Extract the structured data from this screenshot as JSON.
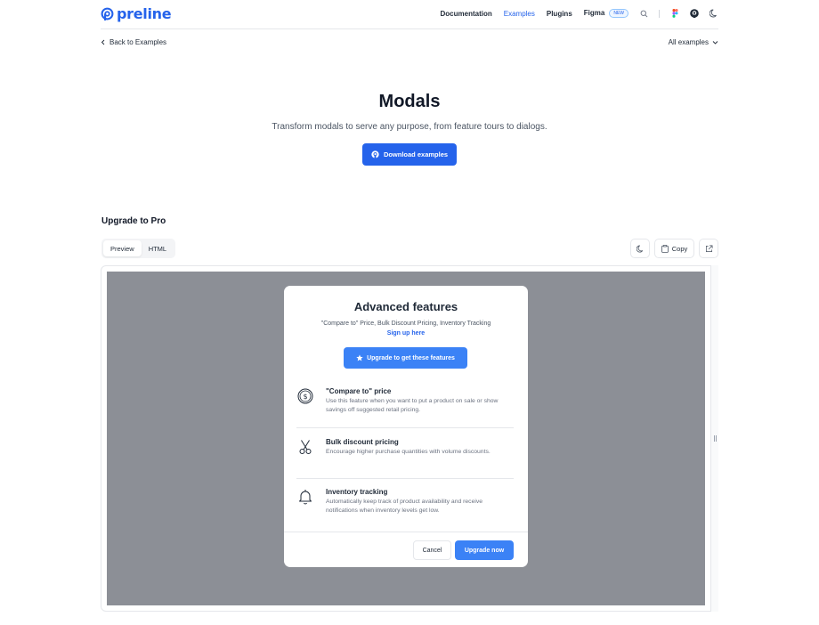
{
  "brand": {
    "name": "preline",
    "accent": "#2563eb"
  },
  "nav": {
    "items": [
      "Documentation",
      "Examples",
      "Plugins",
      "Figma"
    ],
    "active": "Examples",
    "badge": "NEW",
    "icons": [
      "search-icon",
      "figma-icon",
      "github-icon",
      "moon-icon"
    ]
  },
  "subnav": {
    "back": "Back to Examples",
    "all_examples": "All examples"
  },
  "hero": {
    "title": "Modals",
    "subtitle": "Transform modals to serve any purpose, from feature tours to dialogs.",
    "button": "Download examples"
  },
  "section": {
    "title": "Upgrade to Pro",
    "tabs": [
      "Preview",
      "HTML"
    ],
    "active_tab": "Preview",
    "copy_label": "Copy"
  },
  "modal": {
    "title": "Advanced features",
    "desc_text": "\"Compare to\" Price, Bulk Discount Pricing, Inventory Tracking",
    "desc_link": "Sign up here",
    "cta": "Upgrade to get these features",
    "features": [
      {
        "icon": "dollar-circle-icon",
        "title": "\"Compare to\" price",
        "desc": "Use this feature when you want to put a product on sale or show savings off suggested retail pricing."
      },
      {
        "icon": "scissors-icon",
        "title": "Bulk discount pricing",
        "desc": "Encourage higher purchase quantities with volume discounts."
      },
      {
        "icon": "bell-icon",
        "title": "Inventory tracking",
        "desc": "Automatically keep track of product availability and receive notifications when inventory levels get low."
      }
    ],
    "cancel": "Cancel",
    "confirm": "Upgrade now"
  }
}
